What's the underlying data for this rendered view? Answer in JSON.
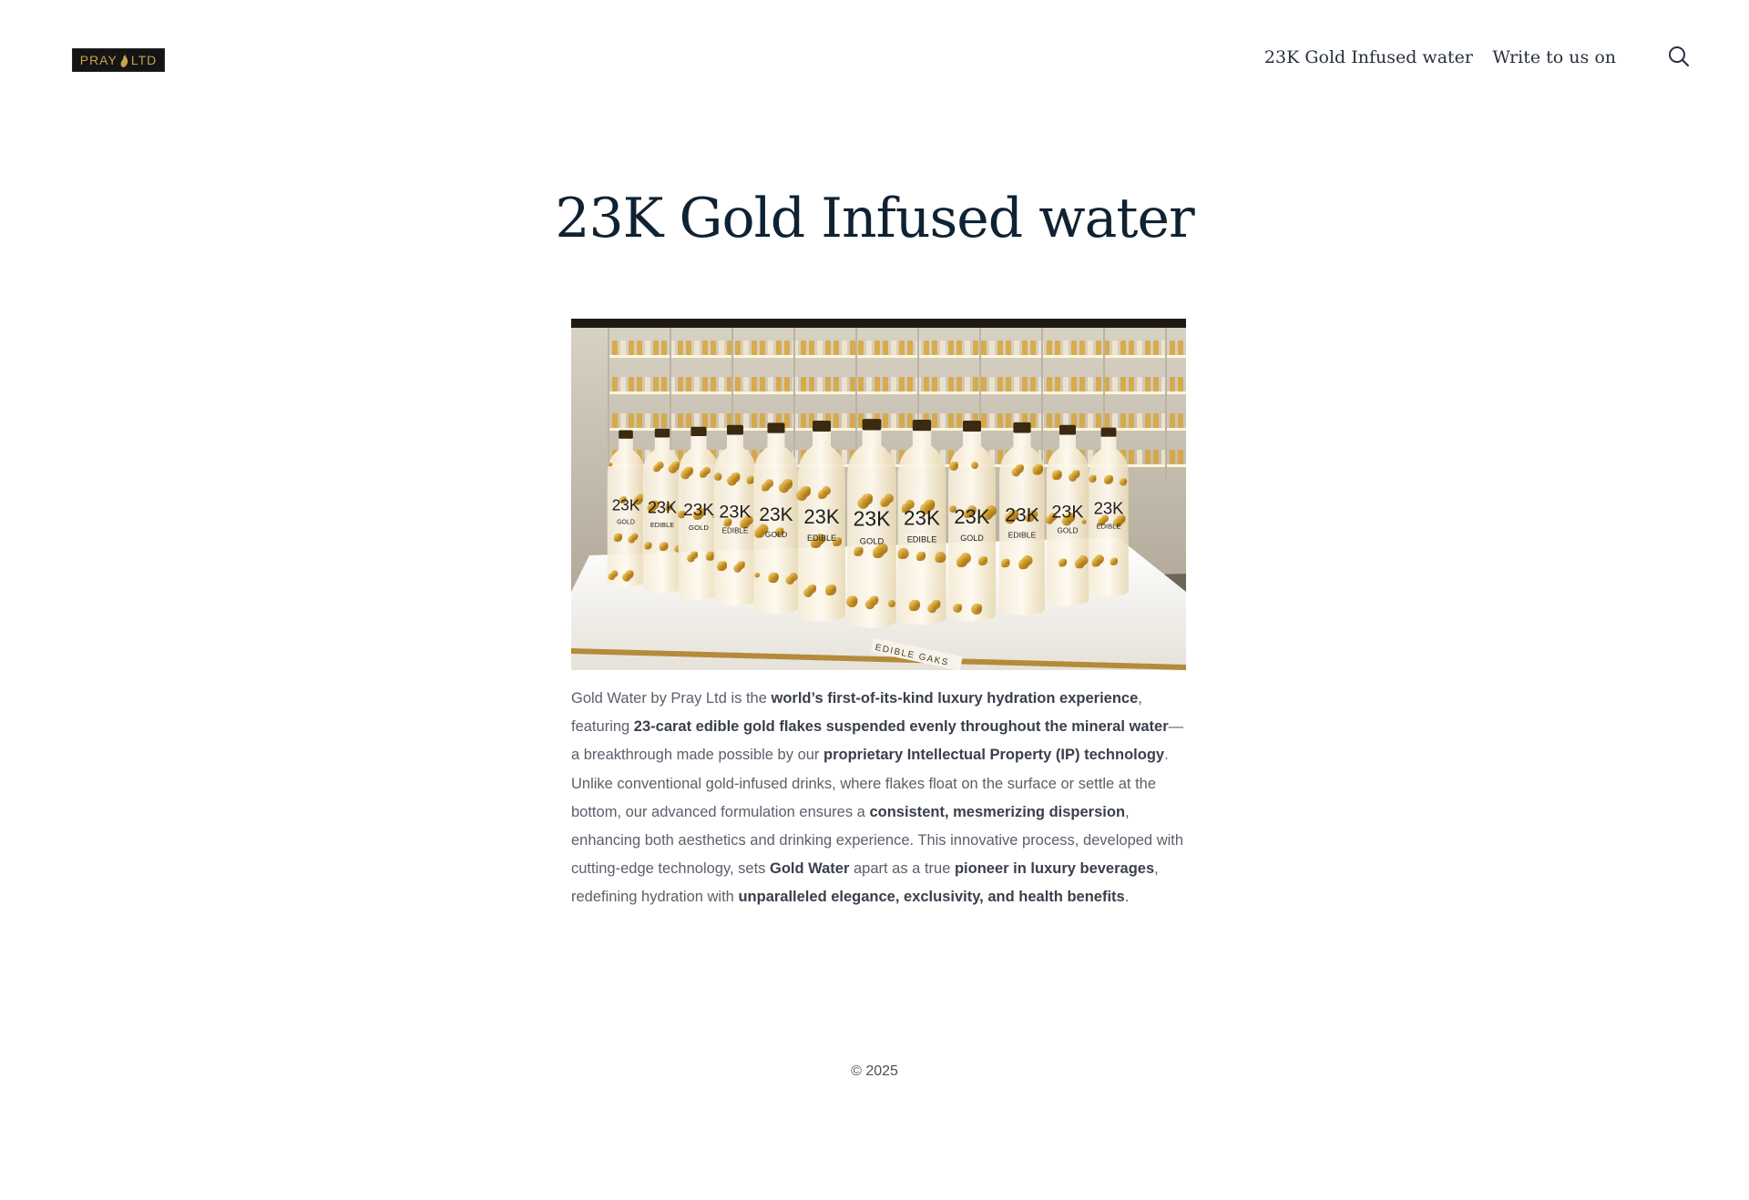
{
  "header": {
    "logo_text_left": "PRAY",
    "logo_text_right": "LTD",
    "nav": [
      {
        "label": "23K Gold Infused water"
      },
      {
        "label": "Write to us on"
      }
    ],
    "search_icon": "search-icon"
  },
  "main": {
    "title": "23K Gold Infused water",
    "hero_image": {
      "bottle_label_big": "23K",
      "bottle_label_small_1": "GOLD",
      "bottle_label_small_2": "EDIBLE",
      "display_sign": "EDIBLE GAKS"
    },
    "paragraph": [
      {
        "text": "Gold Water by Pray Ltd is the ",
        "bold": false
      },
      {
        "text": "world’s first-of-its-kind luxury hydration experience",
        "bold": true
      },
      {
        "text": ", featuring ",
        "bold": false
      },
      {
        "text": "23-carat edible gold flakes suspended evenly throughout the mineral water",
        "bold": true
      },
      {
        "text": "—a breakthrough made possible by our ",
        "bold": false
      },
      {
        "text": "proprietary Intellectual Property (IP) technology",
        "bold": true
      },
      {
        "text": ". Unlike conventional gold-infused drinks, where flakes float on the surface or settle at the bottom, our advanced formulation ensures a ",
        "bold": false
      },
      {
        "text": "consistent, mesmerizing dispersion",
        "bold": true
      },
      {
        "text": ", enhancing both aesthetics and drinking experience. This innovative process, developed with cutting-edge technology, sets ",
        "bold": false
      },
      {
        "text": "Gold Water",
        "bold": true
      },
      {
        "text": " apart as a true ",
        "bold": false
      },
      {
        "text": "pioneer in luxury beverages",
        "bold": true
      },
      {
        "text": ", redefining hydration with ",
        "bold": false
      },
      {
        "text": "unparalleled elegance, exclusivity, and health benefits",
        "bold": true
      },
      {
        "text": ".",
        "bold": false
      }
    ]
  },
  "footer": {
    "copyright": "© 2025"
  },
  "colors": {
    "title": "#0f2233",
    "nav_text": "#28303d",
    "body_text": "#5a606b",
    "gold": "#c9a24a"
  }
}
